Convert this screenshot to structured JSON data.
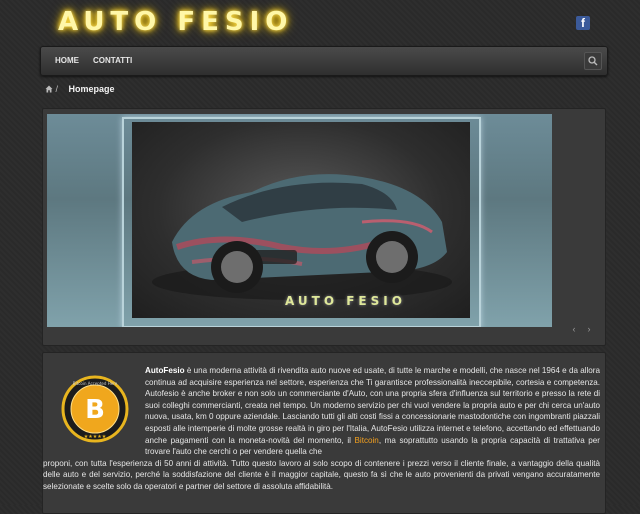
{
  "header": {
    "logo_text": "AUTO FESIO",
    "social_icon": "facebook-icon"
  },
  "nav": {
    "items": [
      {
        "label": "HOME"
      },
      {
        "label": "CONTATTI"
      }
    ],
    "search_icon": "search-icon"
  },
  "breadcrumb": {
    "separator": "/",
    "current": "Homepage"
  },
  "slider": {
    "caption": "AUTO FESIO",
    "prev_symbol": "‹",
    "next_symbol": "›"
  },
  "content": {
    "brand": "AutoFesio",
    "para1_after_brand": " è una moderna attività di rivendita auto nuove ed usate, di tutte le marche e modelli, che nasce nel 1964 e da allora continua ad acquisire esperienza nel settore, esperienza che Ti garantisce professionalità ineccepibile, cortesia e competenza. Autofesio è anche broker e non solo un commerciante d'Auto, con una propria sfera d'influenza sul territorio e presso la rete di suoi colleghi commercianti, creata nel tempo. Un moderno servizio per chi vuol vendere la propria auto e per chi cerca un'auto nuova, usata, km 0 oppure aziendale. Lasciando tutti gli alti costi fissi a concessionarie mastodontiche con ingombranti piazzali esposti alle intemperie di molte grosse realtà in giro per l'Italia, AutoFesio utilizza internet e telefono, accettando ed effettuando anche pagamenti con la moneta-novità del momento, il ",
    "bitcoin_link": "Bitcoin",
    "para1_after_link": ", ma soprattutto usando la propria capacità di trattativa per trovare l'auto che cerchi o per vendere quella che",
    "para1_full_width": "proponi, con tutta l'esperienza di 50 anni di attività. Tutto questo lavoro al solo scopo di contenere i prezzi verso il cliente finale, a vantaggio della qualità delle auto e del servizio, perché la soddisfazione del cliente è il maggior capitale, questo fa sì che le auto provenienti da privati vengano accuratamente selezionate e scelte solo da operatori e partner del settore di assoluta affidabilità.",
    "badge": {
      "ring_text": "Bitcoin Accepted Here",
      "symbol": "B"
    }
  },
  "colors": {
    "logo_glow": "#ffcc00",
    "link": "#f3a01e",
    "facebook": "#3b5a9a",
    "slide_bg": "#6d8c98"
  }
}
